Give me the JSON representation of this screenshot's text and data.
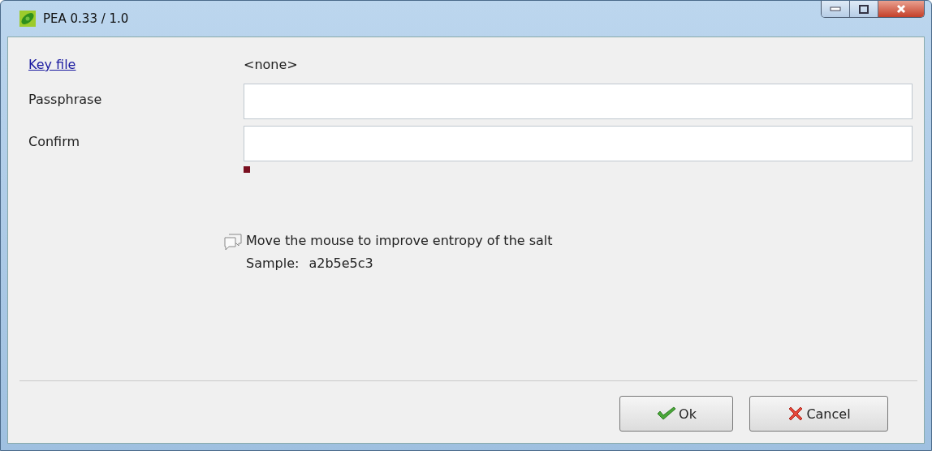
{
  "window": {
    "title": "PEA 0.33 / 1.0"
  },
  "key_file": {
    "link": "Key file",
    "value": "<none>"
  },
  "fields": [
    {
      "label": "Passphrase"
    },
    {
      "label": "Confirm"
    }
  ],
  "message": {
    "text": "Move the mouse to improve entropy of the salt",
    "sample_label": "Sample:",
    "sample_value": "a2b5e5c3"
  },
  "buttons": [
    {
      "label": "Ok",
      "kind": "ok"
    },
    {
      "label": "Cancel",
      "kind": "cancel"
    }
  ]
}
